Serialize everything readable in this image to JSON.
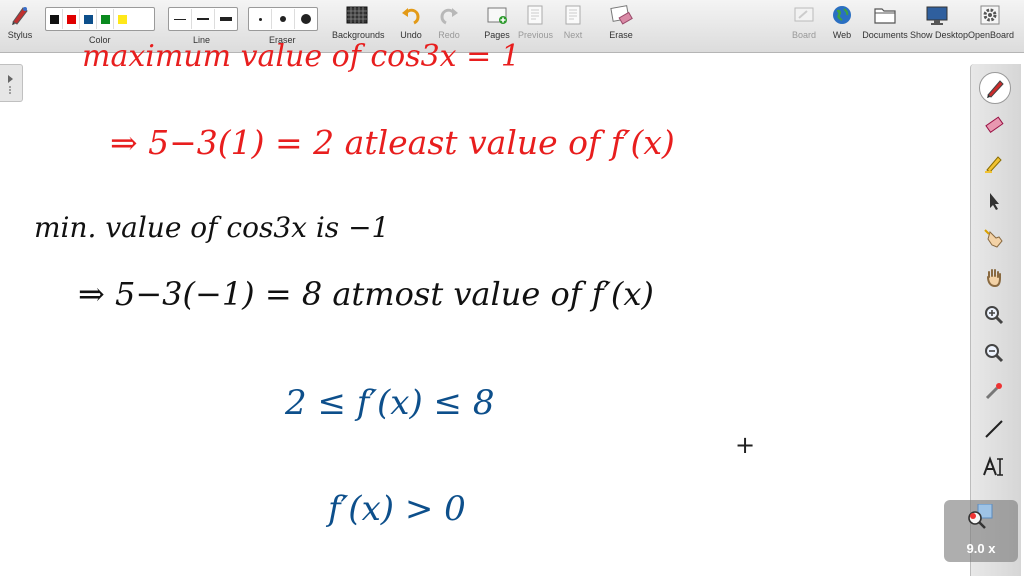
{
  "toolbar": {
    "stylus": "Stylus",
    "color": "Color",
    "line": "Line",
    "eraser": "Eraser",
    "backgrounds": "Backgrounds",
    "undo": "Undo",
    "redo": "Redo",
    "pages": "Pages",
    "previous": "Previous",
    "next": "Next",
    "erase": "Erase",
    "board": "Board",
    "web": "Web",
    "documents": "Documents",
    "show_desktop": "Show Desktop",
    "openboard": "OpenBoard",
    "colors": [
      "#111111",
      "#e00000",
      "#0d4f8b",
      "#0a8a1e",
      "#ffe81a"
    ]
  },
  "board": {
    "line1": "maximum value of cos3x = 1",
    "line2": "⇒ 5−3(1) = 2 atleast value of f′(x)",
    "line3": "min. value of cos3x is −1",
    "line4": "⇒ 5−3(−1) = 8 atmost value of f′(x)",
    "line5": "2 ≤ f′(x) ≤ 8",
    "line6": "f′(x) > 0",
    "cursor": "+"
  },
  "zoom": "9.0 x"
}
